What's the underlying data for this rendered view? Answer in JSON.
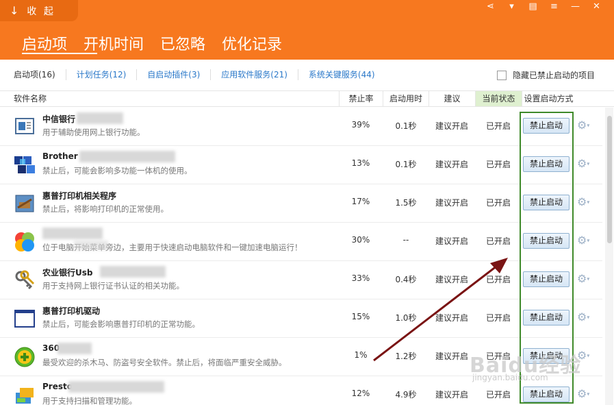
{
  "header": {
    "collapse_label": "收 起",
    "collapse_icon": "arrow-down-icon",
    "window_controls": [
      "share-icon",
      "shirt-icon",
      "message-icon",
      "menu-icon",
      "minimize-icon",
      "close-icon"
    ],
    "main_tabs": [
      "启动项",
      "开机时间",
      "已忽略",
      "优化记录"
    ],
    "active_main_tab": "启动项"
  },
  "subtabs": [
    "启动项(16)",
    "计划任务(12)",
    "自启动插件(3)",
    "应用软件服务(21)",
    "系统关键服务(44)"
  ],
  "hide_disabled": {
    "label": "隐藏已禁止启动的项目",
    "checked": false
  },
  "columns": {
    "name": "软件名称",
    "rate": "禁止率",
    "time": "启动用时",
    "advice": "建议",
    "state": "当前状态",
    "action": "设置启动方式"
  },
  "rows": [
    {
      "name": "中信银行",
      "desc": "用于辅助使用网上银行功能。",
      "rate": "39%",
      "time": "0.1秒",
      "advice": "建议开启",
      "state": "已开启",
      "action": "禁止启动",
      "icon": "bank-app-icon"
    },
    {
      "name": "Brother",
      "desc": "禁止后，可能会影响多功能一体机的使用。",
      "rate": "13%",
      "time": "0.1秒",
      "advice": "建议开启",
      "state": "已开启",
      "action": "禁止启动",
      "icon": "brother-cubes-icon"
    },
    {
      "name": "惠普打印机相关程序",
      "desc": "禁止后，将影响打印机的正常使用。",
      "rate": "17%",
      "time": "1.5秒",
      "advice": "建议开启",
      "state": "已开启",
      "action": "禁止启动",
      "icon": "printer-tool-icon"
    },
    {
      "name": "",
      "desc": "位于电脑开始菜单旁边，主要用于快速启动电脑软件和一键加速电脑运行！",
      "rate": "30%",
      "time": "--",
      "advice": "建议开启",
      "state": "已开启",
      "action": "禁止启动",
      "icon": "colorful-circles-icon"
    },
    {
      "name": "农业银行Usb",
      "desc": "用于支持网上银行证书认证的相关功能。",
      "rate": "33%",
      "time": "0.4秒",
      "advice": "建议开启",
      "state": "已开启",
      "action": "禁止启动",
      "icon": "keys-icon"
    },
    {
      "name": "惠普打印机驱动",
      "desc": "禁止后，可能会影响惠普打印机的正常功能。",
      "rate": "15%",
      "time": "1.0秒",
      "advice": "建议开启",
      "state": "已开启",
      "action": "禁止启动",
      "icon": "window-frame-icon"
    },
    {
      "name": "360",
      "desc": "最受欢迎的杀木马、防盗号安全软件。禁止后，将面临严重安全威胁。",
      "rate": "1%",
      "time": "1.2秒",
      "advice": "建议开启",
      "state": "已开启",
      "action": "禁止启动",
      "icon": "shield-plus-icon"
    },
    {
      "name": "Presto",
      "desc": "用于支持扫描和管理功能。",
      "rate": "12%",
      "time": "4.9秒",
      "advice": "建议开启",
      "state": "已开启",
      "action": "禁止启动",
      "icon": "scanner-icon"
    }
  ],
  "colors": {
    "header": "#f7781f",
    "highlight_box": "#3f8a2a",
    "arrow": "#7a1414",
    "link": "#2a78c9"
  },
  "watermark": {
    "main": "Baidu经验",
    "sub": "jingyan.baidu.com"
  }
}
